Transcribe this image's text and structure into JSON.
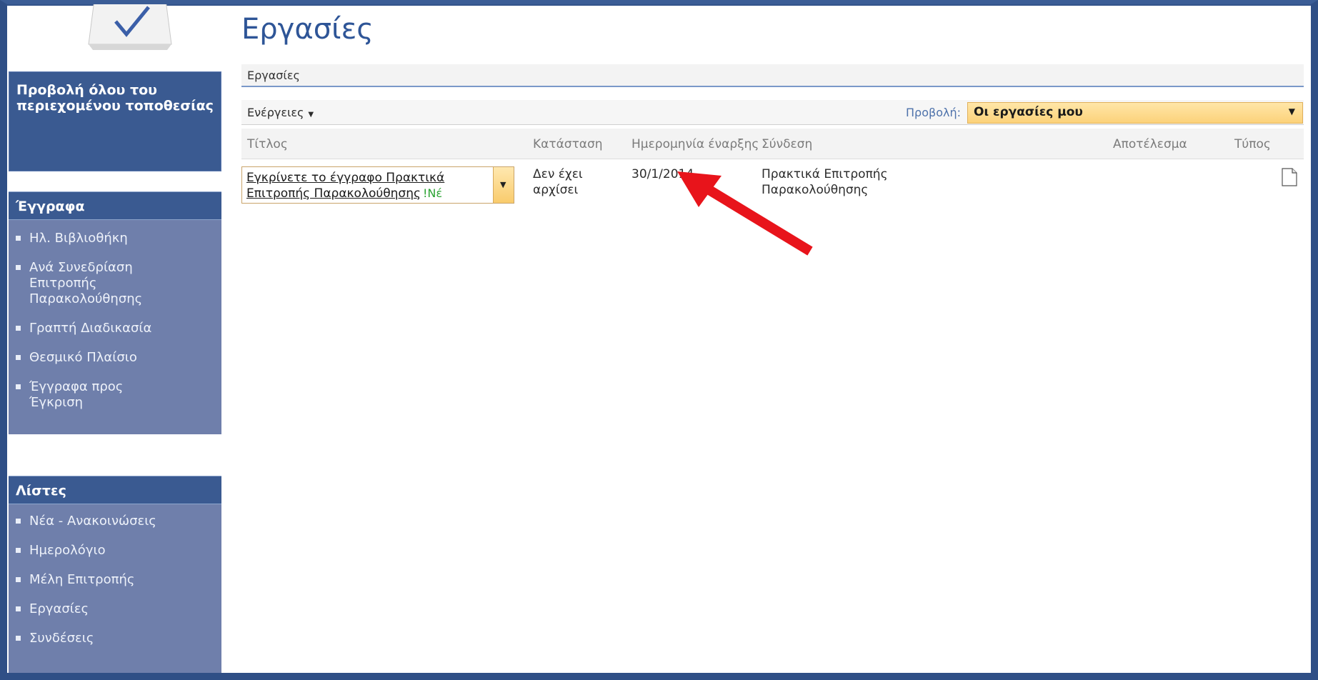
{
  "page": {
    "title": "Εργασίες"
  },
  "breadcrumb": {
    "label": "Εργασίες"
  },
  "toolbar": {
    "actions_label": "Ενέργειες",
    "view_label": "Προβολή:",
    "view_selected": "Οι εργασίες μου"
  },
  "sidebar": {
    "view_all": "Προβολή όλου του περιεχομένου τοποθεσίας",
    "documents": {
      "header": "Έγγραφα",
      "items": [
        {
          "label": "Ηλ. Βιβλιοθήκη"
        },
        {
          "label": "Ανά Συνεδρίαση Επιτροπής Παρακολούθησης"
        },
        {
          "label": "Γραπτή Διαδικασία"
        },
        {
          "label": "Θεσμικό Πλαίσιο"
        },
        {
          "label": "Έγγραφα προς Έγκριση"
        }
      ]
    },
    "lists": {
      "header": "Λίστες",
      "items": [
        {
          "label": "Νέα - Ανακοινώσεις"
        },
        {
          "label": "Ημερολόγιο"
        },
        {
          "label": "Μέλη Επιτροπής"
        },
        {
          "label": "Εργασίες"
        },
        {
          "label": "Συνδέσεις"
        }
      ]
    }
  },
  "table": {
    "columns": {
      "title": "Τίτλος",
      "status": "Κατάσταση",
      "start_date": "Ημερομηνία έναρξης",
      "link": "Σύνδεση",
      "result": "Αποτέλεσμα",
      "type": "Τύπος"
    },
    "rows": [
      {
        "title_line1": "Εγκρίνετε το έγγραφο Πρακτικά",
        "title_line2": "Επιτροπής Παρακολούθησης",
        "new_badge": "Νέ",
        "status_line1": "Δεν έχει",
        "status_line2": "αρχίσει",
        "start_date": "30/1/2014",
        "link_line1": "Πρακτικά Επιτροπής",
        "link_line2": "Παρακολούθησης",
        "type_icon": "document-icon"
      }
    ]
  },
  "colors": {
    "sidebar_header": "#3a5a91",
    "sidebar_items": "#6f7fab",
    "title_blue": "#2e5597",
    "view_select": "#fcd27a",
    "annotation_arrow": "#e8141b"
  }
}
